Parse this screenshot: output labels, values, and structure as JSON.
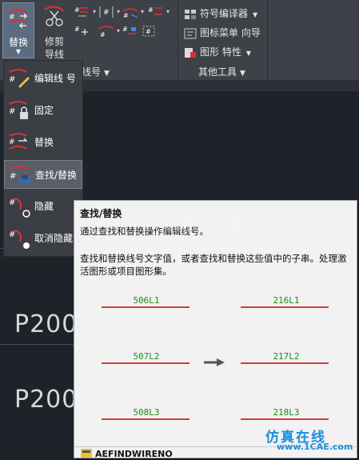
{
  "ribbon": {
    "replace_button": "替换",
    "trim_button": "修剪",
    "trim_button_line2": "导线",
    "panel_wire_title": "线/线号",
    "panel_other_title": "其他工具",
    "symbol_compiler": "符号编译器",
    "icon_menu_wizard": "图标菜单 向导",
    "graphic_properties": "图形 特性"
  },
  "dropdown": {
    "items": [
      {
        "label": "编辑线 号"
      },
      {
        "label": "固定"
      },
      {
        "label": "替换"
      },
      {
        "label": "查找/替换"
      },
      {
        "label": "隐藏"
      },
      {
        "label": "取消隐藏"
      }
    ]
  },
  "canvas": {
    "labels": [
      "P200",
      "P200"
    ]
  },
  "tooltip": {
    "title": "查找/替换",
    "description": "通过查找和替换操作编辑线号。",
    "detail": "查找和替换线号文字值，或者查找和替换这些值中的子串。处理激活图形或项目图形集。",
    "examples": [
      {
        "from": "506L1",
        "to": "216L1"
      },
      {
        "from": "507L2",
        "to": "217L2"
      },
      {
        "from": "508L3",
        "to": "218L3"
      }
    ],
    "command": "AEFINDWIRENO"
  },
  "watermarks": {
    "center": "1CAE.COM",
    "brand": "仿真在线",
    "url": "www.1CAE.com"
  },
  "colors": {
    "ribbon_bg": "#3e4148",
    "canvas_bg": "#1e232a",
    "wire_red": "#d63a3a",
    "wire_text_green": "#1c8a1c",
    "brand_blue": "#1a8fe0"
  }
}
